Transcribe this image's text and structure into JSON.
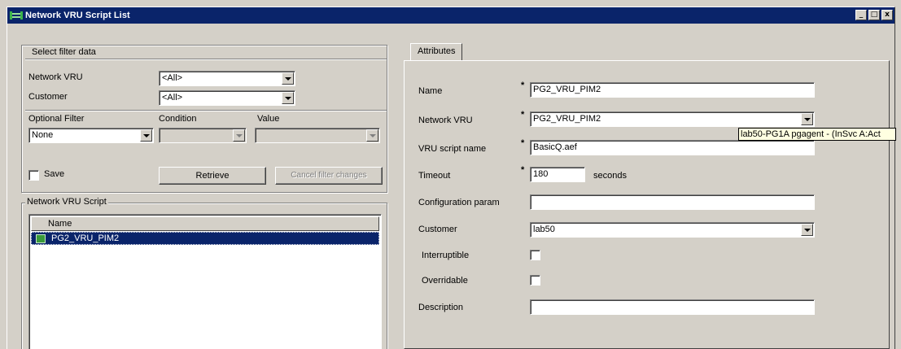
{
  "window": {
    "title": "Network VRU Script List",
    "minimize": "_",
    "maximize": "□",
    "close": "x"
  },
  "filter": {
    "group_label": "Select filter data",
    "network_vru_label": "Network VRU",
    "network_vru_value": "<All>",
    "customer_label": "Customer",
    "customer_value": "<All>",
    "optional_filter_label": "Optional Filter",
    "optional_filter_value": "None",
    "condition_label": "Condition",
    "condition_value": "",
    "value_label": "Value",
    "value_value": "",
    "save_label": "Save",
    "save_checked": false,
    "retrieve_label": "Retrieve",
    "cancel_label": "Cancel filter changes"
  },
  "script_list": {
    "group_label": "Network VRU Script",
    "column_name": "Name",
    "rows": [
      {
        "name": "PG2_VRU_PIM2",
        "selected": true
      }
    ]
  },
  "attributes": {
    "tab_label": "Attributes",
    "name_label": "Name",
    "name_value": "PG2_VRU_PIM2",
    "network_vru_label": "Network VRU",
    "network_vru_value": "PG2_VRU_PIM2",
    "vru_script_name_label": "VRU script name",
    "vru_script_name_value": "BasicQ.aef",
    "timeout_label": "Timeout",
    "timeout_value": "180",
    "timeout_unit": "seconds",
    "config_param_label": "Configuration param",
    "config_param_value": "",
    "customer_label": "Customer",
    "customer_value": "lab50",
    "interruptible_label": "Interruptible",
    "interruptible_checked": false,
    "overridable_label": "Overridable",
    "overridable_checked": false,
    "description_label": "Description",
    "description_value": "",
    "required_marker": "*",
    "tooltip": "lab50-PG1A pgagent - (InSvc A:Act"
  },
  "colors": {
    "titlebar": "#0a246a",
    "face": "#d4d0c8",
    "selection": "#0a246a",
    "tooltip_bg": "#ffffe1"
  }
}
